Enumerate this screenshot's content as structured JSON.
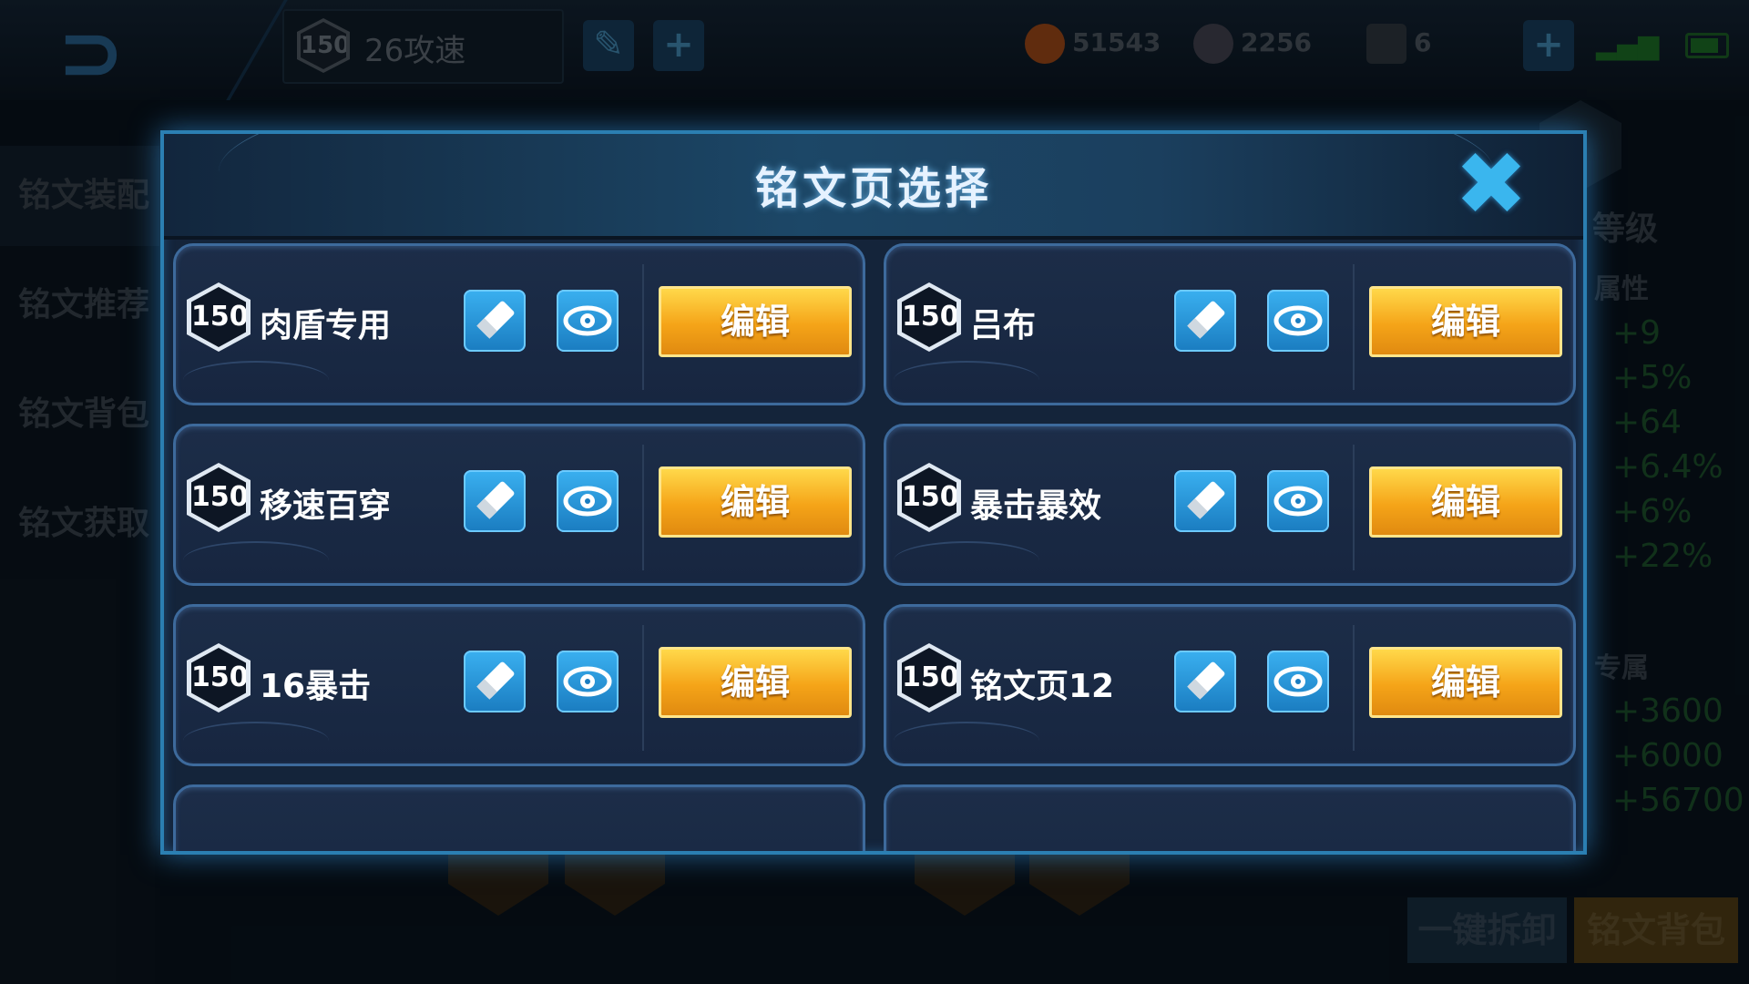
{
  "background": {
    "selected_page": {
      "level": "150",
      "name": "26攻速"
    },
    "currencies": [
      {
        "name": "gold",
        "value": "51543",
        "color": "#c65a1c"
      },
      {
        "name": "diamond",
        "value": "2256",
        "color": "#6a6a7a"
      },
      {
        "name": "ticket",
        "value": "6",
        "color": "#4a5560"
      }
    ],
    "nav": [
      "铭文装配",
      "铭文推荐",
      "铭文背包",
      "铭文获取"
    ],
    "right_panel": {
      "level_label": "等级",
      "attr_label": "属性",
      "attr_values": [
        "+9",
        "+5%",
        "+64",
        "+6.4%",
        "+6%",
        "+22%"
      ],
      "exclusive_label": "专属",
      "exclusive_values": [
        "+3600",
        "+6000",
        "+56700"
      ]
    },
    "bottom_buttons": [
      "一键拆卸",
      "铭文背包"
    ]
  },
  "modal": {
    "title": "铭文页选择",
    "close_icon": "close-icon",
    "edit_label": "编辑",
    "pages": [
      {
        "level": "150",
        "name": "肉盾专用"
      },
      {
        "level": "150",
        "name": "吕布"
      },
      {
        "level": "150",
        "name": "移速百穿"
      },
      {
        "level": "150",
        "name": "暴击暴效"
      },
      {
        "level": "150",
        "name": "16暴击"
      },
      {
        "level": "150",
        "name": "铭文页12"
      }
    ]
  },
  "colors": {
    "accent_blue": "#3ab6ee",
    "edit_gold": "#f5a418",
    "modal_border": "#2b7fb2"
  }
}
